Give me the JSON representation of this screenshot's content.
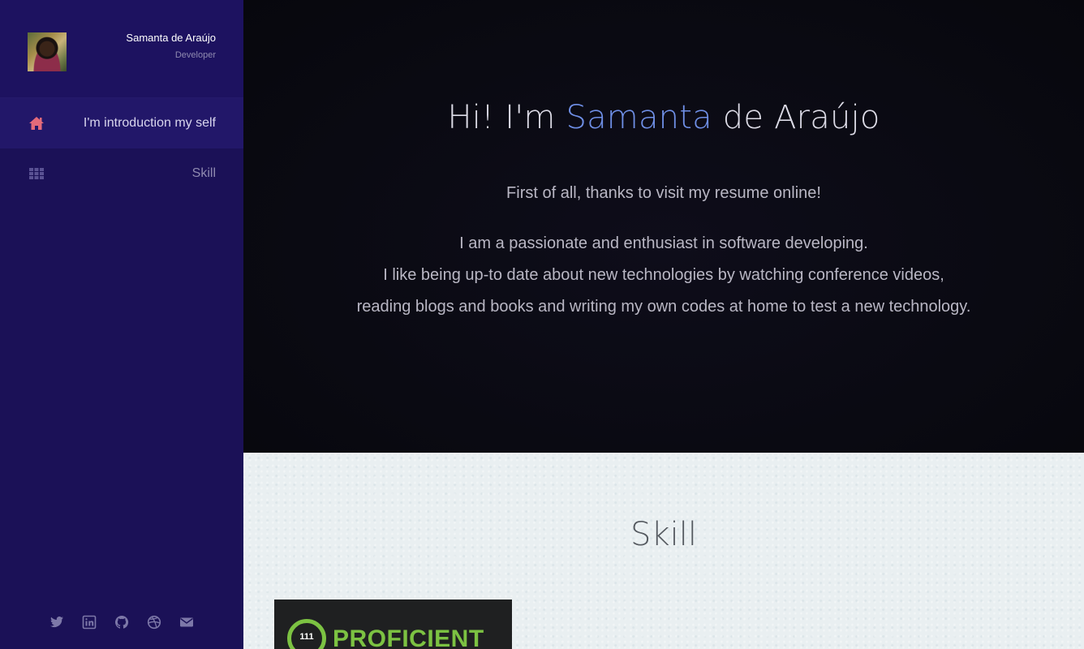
{
  "sidebar": {
    "profile": {
      "name": "Samanta de Araújo",
      "role": "Developer",
      "avatar_icon": "avatar-photo"
    },
    "nav": [
      {
        "label": "I'm introduction my self",
        "icon": "home-icon",
        "active": true
      },
      {
        "label": "Skill",
        "icon": "grid-icon",
        "active": false
      }
    ],
    "socials": [
      "twitter-icon",
      "linkedin-icon",
      "github-icon",
      "dribbble-icon",
      "envelope-icon"
    ]
  },
  "hero": {
    "greeting": "Hi! I'm",
    "first_name": "Samanta",
    "last_name": "de Araújo",
    "line1": "First of all, thanks to visit my resume online!",
    "line2": "I am a passionate and enthusiast in software developing.",
    "line3": "I like being up-to date about new technologies by watching conference videos,",
    "line4": "reading blogs and books and writing my own codes at home to test a new technology."
  },
  "skill": {
    "title": "Skill",
    "badge": {
      "number": "111",
      "text": "PROFICIENT"
    }
  },
  "colors": {
    "sidebar_bg": "#1b1157",
    "accent_name": "#6f8fe6",
    "home_icon": "#e36a7a",
    "badge_green": "#7cc242"
  }
}
